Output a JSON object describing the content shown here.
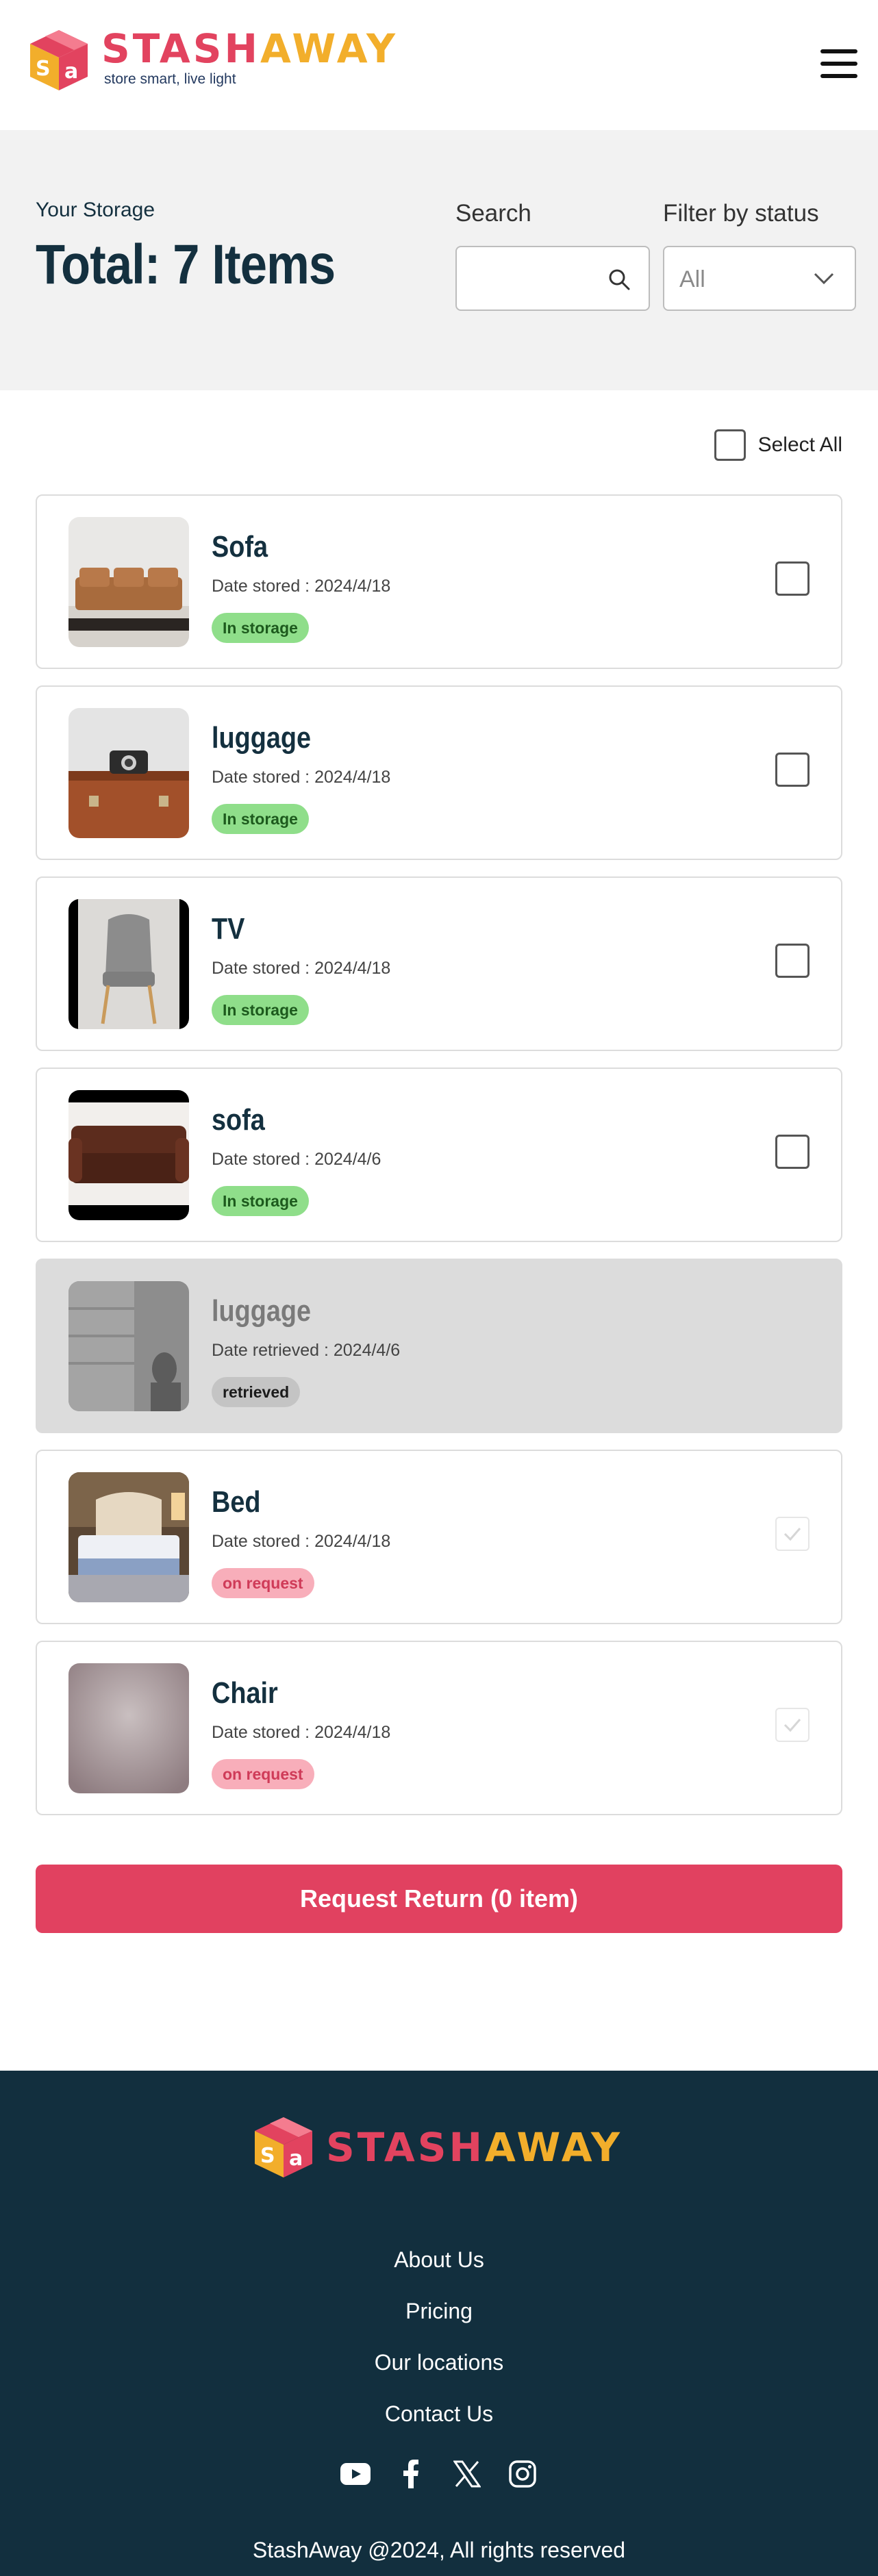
{
  "brand": {
    "name_part1": "STASH",
    "name_part2": "AWAY",
    "tagline": "store smart, live light"
  },
  "summary": {
    "section_label": "Your Storage",
    "total": "Total: 7 Items",
    "search_label": "Search",
    "search_value": "",
    "filter_label": "Filter by status",
    "filter_value": "All"
  },
  "select_all_label": "Select All",
  "items": [
    {
      "name": "Sofa",
      "date": "Date stored : 2024/4/18",
      "status": "In storage",
      "checked": false
    },
    {
      "name": "luggage",
      "date": "Date stored : 2024/4/18",
      "status": "In storage",
      "checked": false
    },
    {
      "name": "TV",
      "date": "Date stored : 2024/4/18",
      "status": "In storage",
      "checked": false
    },
    {
      "name": "sofa",
      "date": "Date stored : 2024/4/6",
      "status": "In storage",
      "checked": false
    },
    {
      "name": "luggage",
      "date": "Date retrieved : 2024/4/6",
      "status": "retrieved",
      "checked": false
    },
    {
      "name": "Bed",
      "date": "Date stored : 2024/4/18",
      "status": "on request",
      "checked": true
    },
    {
      "name": "Chair",
      "date": "Date stored : 2024/4/18",
      "status": "on request",
      "checked": true
    }
  ],
  "cta_label": "Request Return (0 item)",
  "footer": {
    "links": [
      "About Us",
      "Pricing",
      "Our locations",
      "Contact Us"
    ],
    "socials": [
      "youtube-icon",
      "facebook-icon",
      "x-icon",
      "instagram-icon"
    ],
    "copyright": "StashAway @2024, All rights reserved"
  },
  "colors": {
    "brand_pink": "#e2435f",
    "brand_yellow": "#f2ae2b",
    "navy": "#122f3e",
    "cta": "#e14160",
    "badge_in_storage": "#8fde8a",
    "badge_on_request": "#f8aeba"
  }
}
